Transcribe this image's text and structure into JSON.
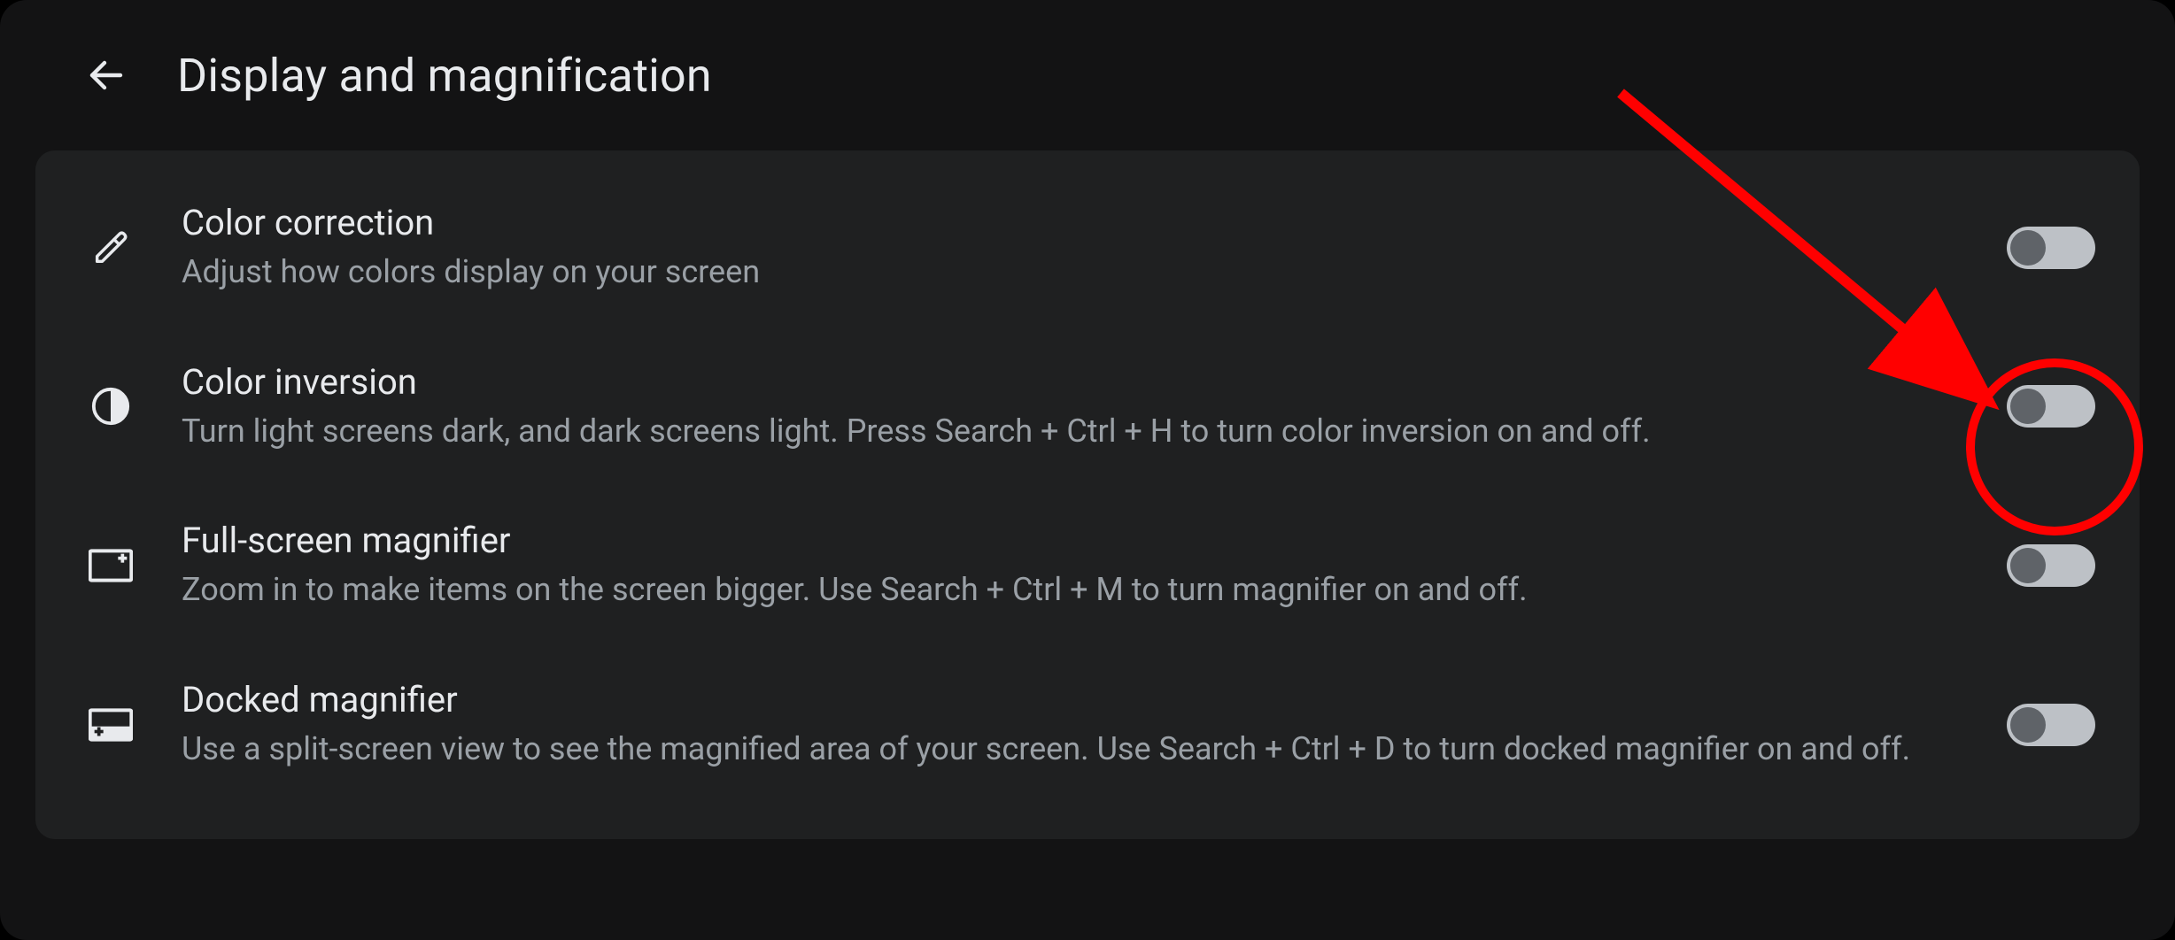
{
  "header": {
    "title": "Display and magnification"
  },
  "rows": [
    {
      "id": "color-correction",
      "icon": "eyedropper-icon",
      "title": "Color correction",
      "desc": "Adjust how colors display on your screen",
      "toggle": false
    },
    {
      "id": "color-inversion",
      "icon": "contrast-icon",
      "title": "Color inversion",
      "desc": "Turn light screens dark, and dark screens light. Press Search + Ctrl + H to turn color inversion on and off.",
      "toggle": false
    },
    {
      "id": "fullscreen-magnifier",
      "icon": "fullscreen-magnifier-icon",
      "title": "Full-screen magnifier",
      "desc": "Zoom in to make items on the screen bigger. Use Search + Ctrl + M to turn magnifier on and off.",
      "toggle": false
    },
    {
      "id": "docked-magnifier",
      "icon": "docked-magnifier-icon",
      "title": "Docked magnifier",
      "desc": "Use a split-screen view to see the magnified area of your screen. Use Search + Ctrl + D to turn docked magnifier on and off.",
      "toggle": false
    }
  ],
  "annotation": {
    "type": "circle-arrow",
    "target_row": "color-inversion",
    "color": "#ff0000"
  }
}
